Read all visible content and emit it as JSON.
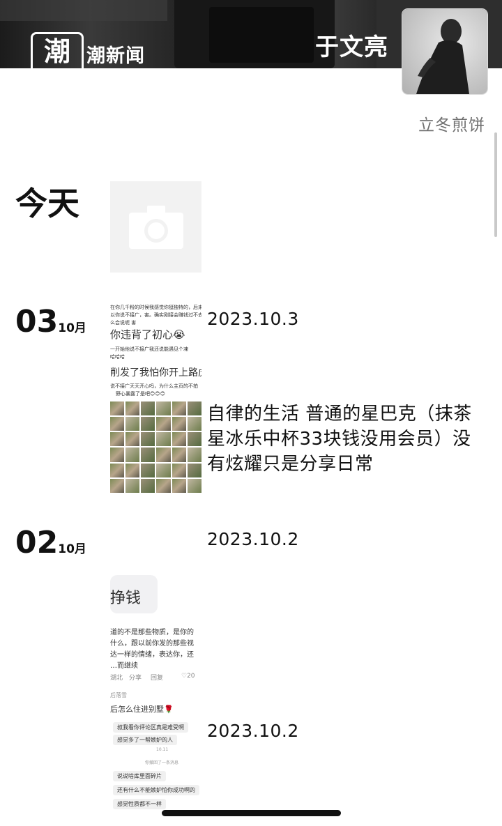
{
  "header": {
    "brand_char": "潮",
    "brand_name": "潮新闻",
    "username": "于文亮",
    "signature": "立冬煎饼"
  },
  "timeline": {
    "today_label": "今天",
    "posts": [
      {
        "day": "03",
        "month": "10月",
        "date": "2023.10.3",
        "caption": "自律的生活 普通的星巴克（抹茶星冰乐中杯33块钱没用会员）没有炫耀只是分享日常",
        "screenshot_lines": [
          "在你几千粉的时候我感觉你挺独特的，后来看",
          "以你说不接广，害。确实刚接会赚钱过不去。",
          "么会说呢 害",
          "你违背了初心😭",
          "一开始他说不接广我还说能遇见个凍",
          "哈哈哈",
          "削发了我怕你开上路虎",
          "说不接广天天开心吗，为什么主页的不拍",
          "野心暴露了是吧😊😊😊"
        ]
      },
      {
        "day": "02",
        "month": "10月",
        "date": "2023.10.2",
        "screenshot_lines": [
          "挣钱",
          "道的不是那些物质，是你的",
          "什么，跟以前你发的那些视",
          "达一样的情绪，表达你，还",
          "…而继续",
          "湖北",
          "分享",
          "回复",
          "♡20",
          "后落雪",
          "后怎么住进别墅🌹"
        ]
      },
      {
        "date": "2023.10.2",
        "screenshot_lines": [
          "叔我看你评论区真是难受啊",
          "感觉多了一帮嫉妒的人",
          "10.11",
          "你撤回了一条消息",
          "说说啥库里面碎片",
          "还有什么不能嫉妒怕你成功啊的",
          "感觉性质都不一样"
        ]
      }
    ]
  },
  "colors": {
    "text": "#111111",
    "muted": "#707070",
    "background": "#ffffff"
  }
}
